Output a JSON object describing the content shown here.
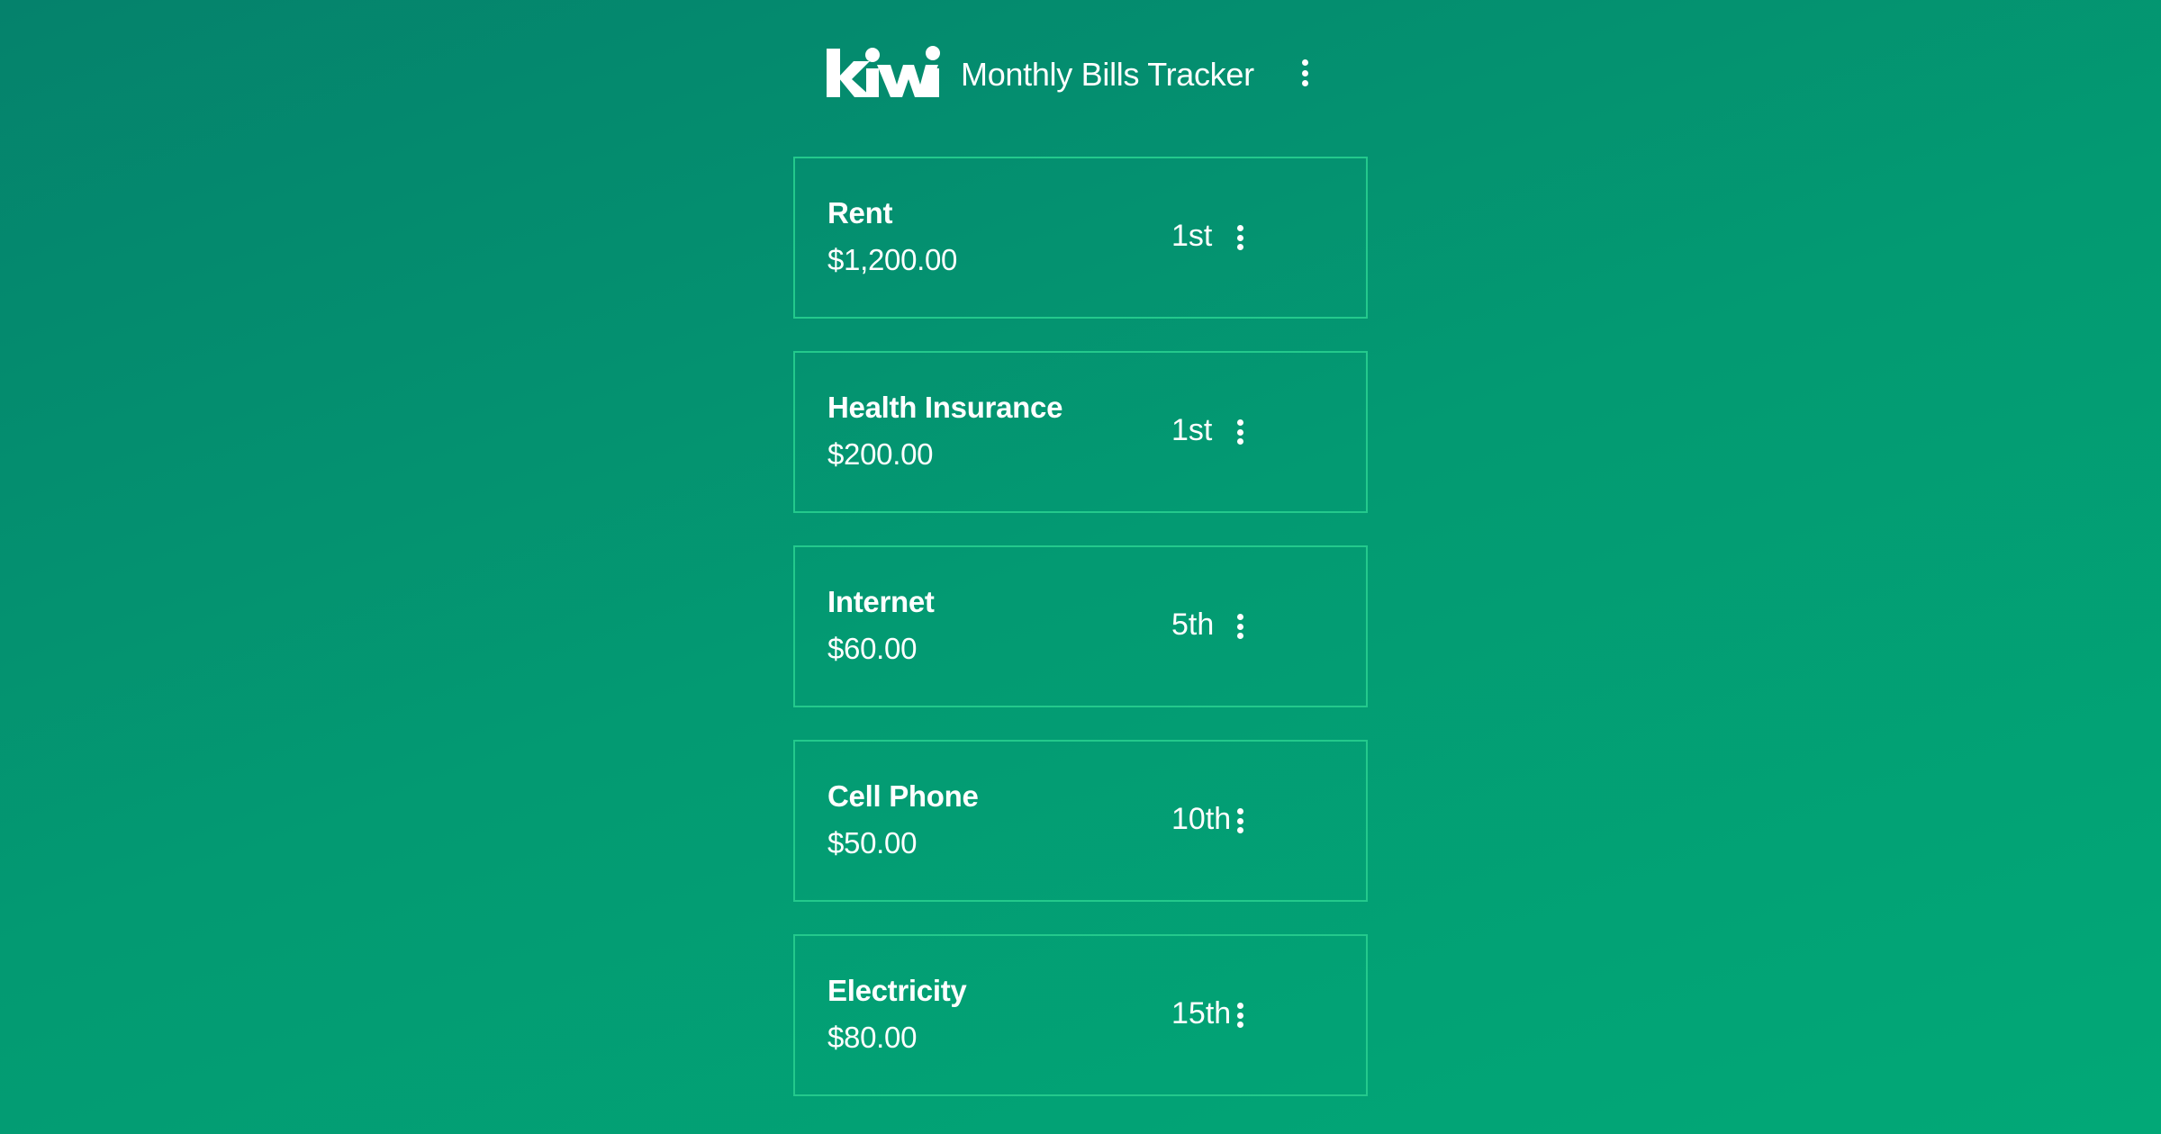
{
  "header": {
    "logo_text": "kiwi",
    "title": "Monthly Bills Tracker",
    "menu_icon": "more-vert-icon"
  },
  "bills": [
    {
      "name": "Rent",
      "amount": "$1,200.00",
      "due": "1st"
    },
    {
      "name": "Health Insurance",
      "amount": "$200.00",
      "due": "1st"
    },
    {
      "name": "Internet",
      "amount": "$60.00",
      "due": "5th"
    },
    {
      "name": "Cell Phone",
      "amount": "$50.00",
      "due": "10th"
    },
    {
      "name": "Electricity",
      "amount": "$80.00",
      "due": "15th"
    }
  ],
  "colors": {
    "background_start": "#05826c",
    "background_end": "#02a877",
    "card_border": "#24c98c",
    "text": "#ffffff"
  }
}
